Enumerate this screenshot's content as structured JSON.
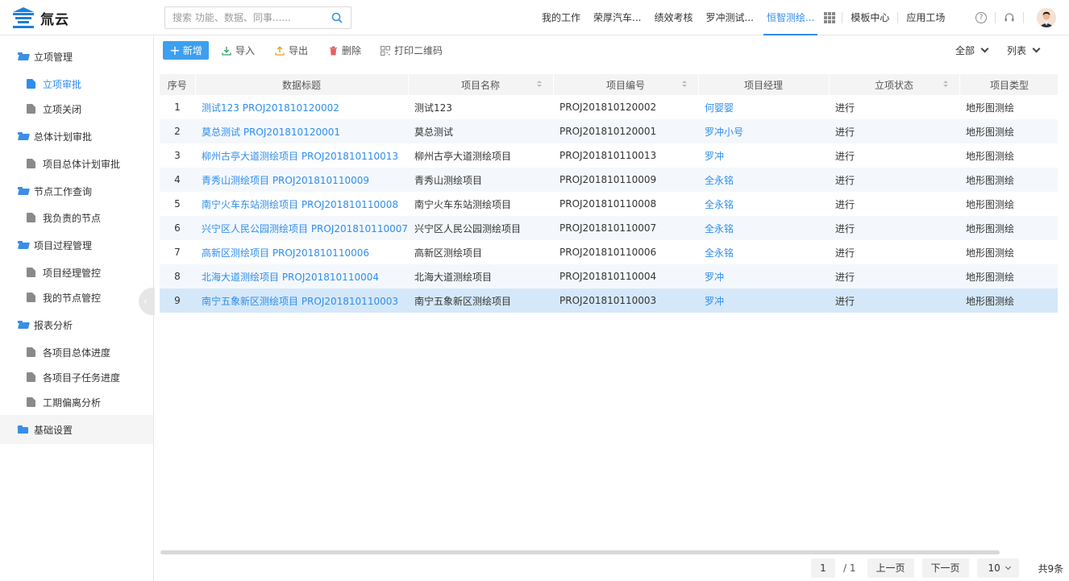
{
  "header": {
    "logo_text": "氚云",
    "search_placeholder": "搜索 功能、数据、同事......",
    "nav": [
      "我的工作",
      "荣厚汽车...",
      "绩效考核",
      "罗冲测试...",
      "恒智测绘..."
    ],
    "nav_active_index": 4,
    "nav_right": [
      "模板中心",
      "应用工场"
    ],
    "help_glyph": "?",
    "accent_color": "#2e8ded"
  },
  "sidebar": {
    "groups": [
      {
        "label": "立项管理",
        "items": [
          {
            "label": "立项审批",
            "active": true
          },
          {
            "label": "立项关闭"
          }
        ]
      },
      {
        "label": "总体计划审批",
        "items": [
          {
            "label": "项目总体计划审批"
          }
        ]
      },
      {
        "label": "节点工作查询",
        "items": [
          {
            "label": "我负责的节点"
          }
        ]
      },
      {
        "label": "项目过程管理",
        "items": [
          {
            "label": "项目经理管控"
          },
          {
            "label": "我的节点管控"
          }
        ]
      },
      {
        "label": "报表分析",
        "items": [
          {
            "label": "各项目总体进度"
          },
          {
            "label": "各项目子任务进度"
          },
          {
            "label": "工期偏离分析"
          }
        ]
      },
      {
        "label": "基础设置",
        "items": []
      }
    ],
    "collapse_glyph": "‹"
  },
  "toolbar": {
    "new_label": "新增",
    "import_label": "导入",
    "export_label": "导出",
    "delete_label": "删除",
    "print_qr_label": "打印二维码",
    "filter_label": "全部",
    "view_label": "列表"
  },
  "table": {
    "columns": [
      "序号",
      "数据标题",
      "项目名称",
      "项目编号",
      "项目经理",
      "立项状态",
      "项目类型"
    ],
    "rows": [
      {
        "no": "1",
        "title": "测试123 PROJ201810120002",
        "name": "测试123",
        "code": "PROJ201810120002",
        "manager": "何婴婴",
        "status": "进行",
        "type": "地形图测绘"
      },
      {
        "no": "2",
        "title": "莫总测试 PROJ201810120001",
        "name": "莫总测试",
        "code": "PROJ201810120001",
        "manager": "罗冲小号",
        "status": "进行",
        "type": "地形图测绘"
      },
      {
        "no": "3",
        "title": "柳州古亭大道测绘项目 PROJ201810110013",
        "name": "柳州古亭大道测绘项目",
        "code": "PROJ201810110013",
        "manager": "罗冲",
        "status": "进行",
        "type": "地形图测绘"
      },
      {
        "no": "4",
        "title": "青秀山测绘项目 PROJ201810110009",
        "name": "青秀山测绘项目",
        "code": "PROJ201810110009",
        "manager": "全永铭",
        "status": "进行",
        "type": "地形图测绘"
      },
      {
        "no": "5",
        "title": "南宁火车东站测绘项目 PROJ201810110008",
        "name": "南宁火车东站测绘项目",
        "code": "PROJ201810110008",
        "manager": "全永铭",
        "status": "进行",
        "type": "地形图测绘"
      },
      {
        "no": "6",
        "title": "兴宁区人民公园测绘项目 PROJ201810110007",
        "name": "兴宁区人民公园测绘项目",
        "code": "PROJ201810110007",
        "manager": "全永铭",
        "status": "进行",
        "type": "地形图测绘"
      },
      {
        "no": "7",
        "title": "高新区测绘项目 PROJ201810110006",
        "name": "高新区测绘项目",
        "code": "PROJ201810110006",
        "manager": "全永铭",
        "status": "进行",
        "type": "地形图测绘"
      },
      {
        "no": "8",
        "title": "北海大道测绘项目 PROJ201810110004",
        "name": "北海大道测绘项目",
        "code": "PROJ201810110004",
        "manager": "罗冲",
        "status": "进行",
        "type": "地形图测绘"
      },
      {
        "no": "9",
        "title": "南宁五象新区测绘项目 PROJ201810110003",
        "name": "南宁五象新区测绘项目",
        "code": "PROJ201810110003",
        "manager": "罗冲",
        "status": "进行",
        "type": "地形图测绘",
        "selected": true
      }
    ]
  },
  "pagination": {
    "current_page": "1",
    "total_pages": "/ 1",
    "prev_label": "上一页",
    "next_label": "下一页",
    "page_size": "10",
    "total_count": "共9条"
  }
}
